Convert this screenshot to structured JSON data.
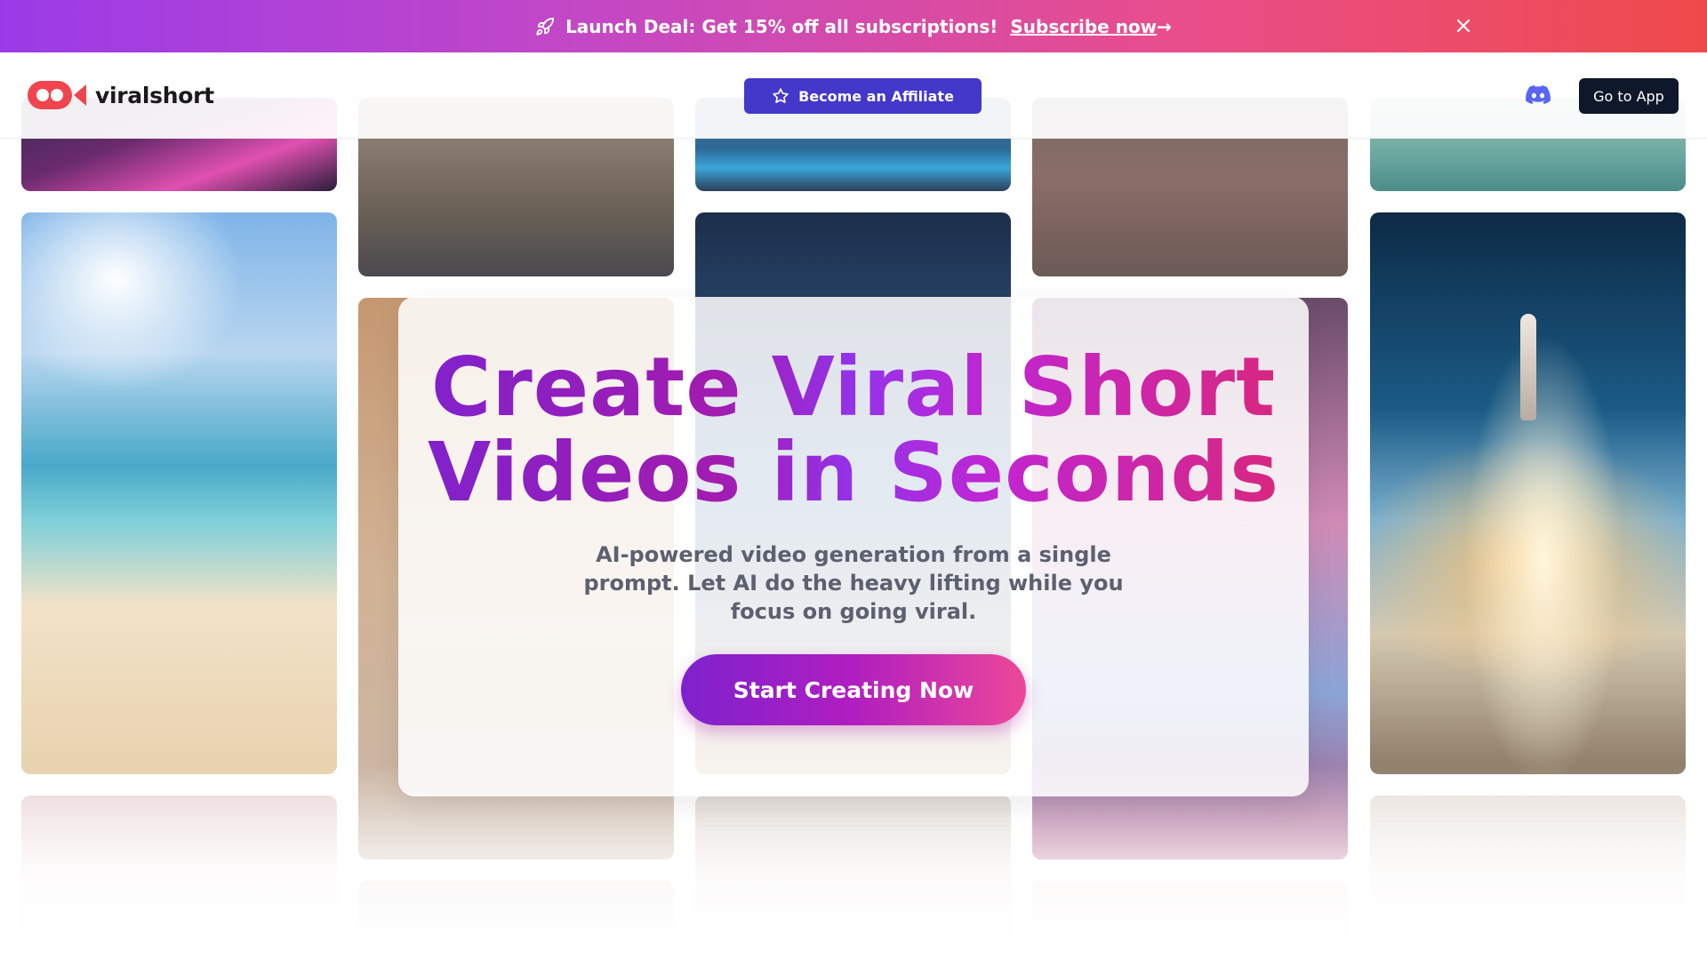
{
  "banner": {
    "icon": "rocket-icon",
    "text": "Launch Deal: Get 15% off all subscriptions!",
    "link_label": "Subscribe now",
    "link_arrow": "→",
    "close_icon": "close-icon"
  },
  "header": {
    "logo_text": "viralshort",
    "affiliate_label": "Become an Affiliate",
    "affiliate_icon": "star-icon",
    "discord_icon": "discord-icon",
    "go_to_app_label": "Go to App"
  },
  "hero": {
    "headline_line1": "Create Viral Short",
    "headline_line2": "Videos in Seconds",
    "subtitle": "AI-powered video generation from a single prompt. Let AI do the heavy lifting while you focus on going viral.",
    "cta_label": "Start Creating Now"
  },
  "colors": {
    "banner_gradient": [
      "#9b3be8",
      "#ef4a4a"
    ],
    "affiliate_button": "#4338ca",
    "go_to_app_button": "#0f172a",
    "headline_gradient": [
      "#7e22ce",
      "#db2777"
    ],
    "cta_gradient": [
      "#7e22ce",
      "#ec4899"
    ]
  }
}
